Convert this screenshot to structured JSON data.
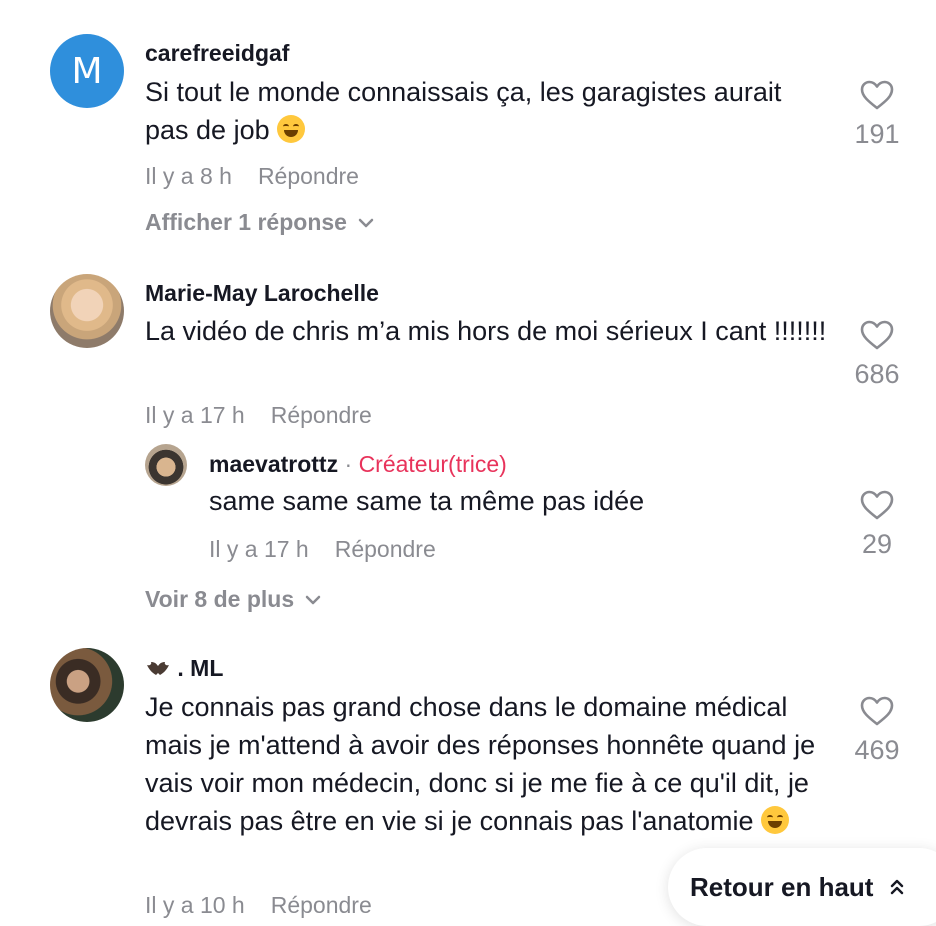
{
  "comments": [
    {
      "avatar_letter": "M",
      "username": "carefreeidgaf",
      "text": "Si tout le monde connaissais ça, les garagistes aurait pas de job",
      "emoji": "rolling-on-floor-laughing",
      "time": "Il y a 8 h",
      "reply_label": "Répondre",
      "likes": "191",
      "replies_toggle": "Afficher 1 réponse"
    },
    {
      "username": "Marie-May Larochelle",
      "text": "La vidéo de chris m’a mis hors de moi sérieux I cant !!!!!!!",
      "time": "Il y a 17 h",
      "reply_label": "Répondre",
      "likes": "686",
      "reply": {
        "username": "maevatrottz",
        "separator": " · ",
        "badge": "Créateur(trice)",
        "text": "same same same ta même pas idée",
        "time": "Il y a 17 h",
        "reply_label": "Répondre",
        "likes": "29"
      },
      "more_toggle": "Voir 8 de plus"
    },
    {
      "username": ". ML",
      "username_icon": "bat-emoji",
      "text": "Je connais pas grand chose dans le domaine médical mais je m'attend à avoir des réponses honnête quand je vais voir mon médecin, donc si je me fie à ce qu'il dit, je devrais pas être en vie si je connais pas l'anatomie",
      "emoji": "face-with-tears-of-joy",
      "time": "Il y a 10 h",
      "reply_label": "Répondre",
      "likes": "469"
    }
  ],
  "back_to_top": "Retour en haut",
  "colors": {
    "text": "#161823",
    "muted": "#8a8b91",
    "creator": "#e8335b",
    "avatar_blue": "#2f8fdc"
  }
}
